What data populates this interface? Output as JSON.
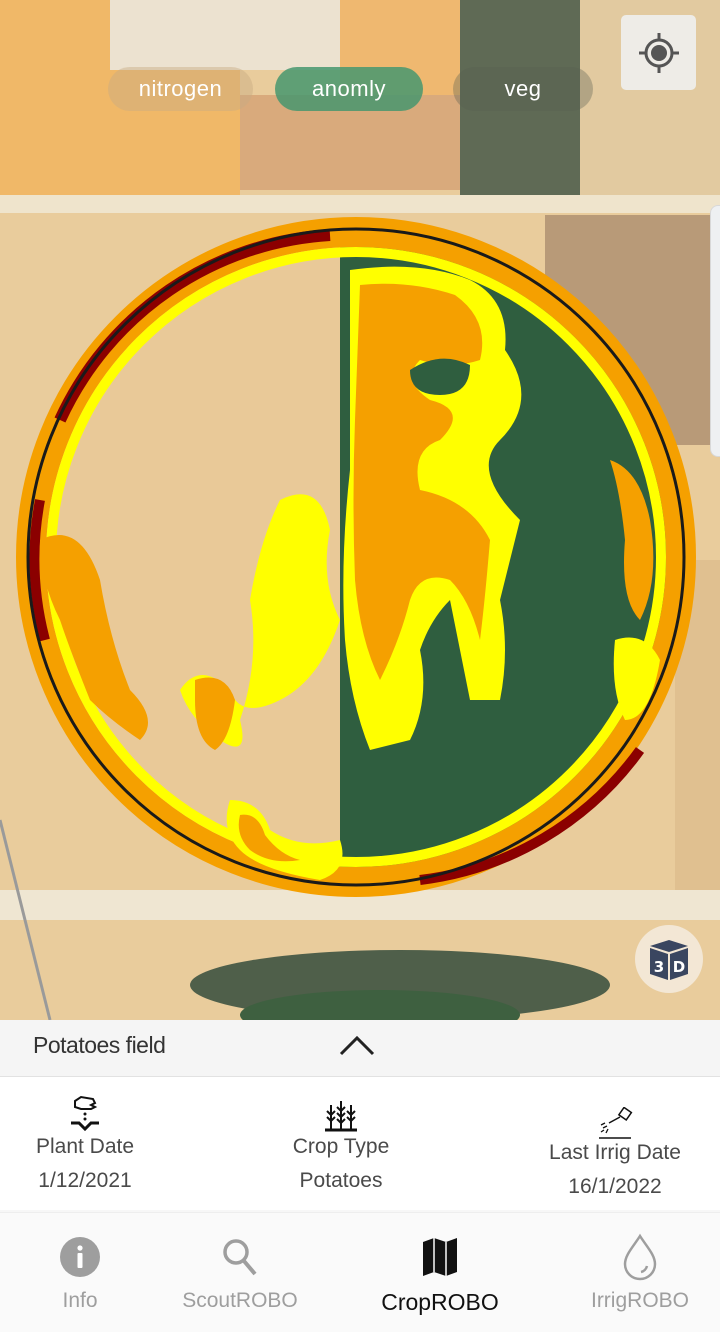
{
  "map": {
    "layer_tabs": [
      {
        "label": "nitrogen",
        "selected": false
      },
      {
        "label": "anomly",
        "selected": true
      },
      {
        "label": "veg",
        "selected": false
      }
    ],
    "locate_icon": "crosshair-locate-icon",
    "view_3d_label": "3D",
    "anomaly_colors": {
      "severe": "#8b0000",
      "high": "#f5a000",
      "moderate": "#ffff00",
      "boundary": "#1a1a1a"
    }
  },
  "field": {
    "name": "Potatoes field",
    "expand_icon": "chevron-up-icon"
  },
  "info": [
    {
      "icon": "hand-sowing-icon",
      "label": "Plant Date",
      "value": "1/12/2021"
    },
    {
      "icon": "wheat-crop-icon",
      "label": "Crop Type",
      "value": "Potatoes"
    },
    {
      "icon": "watering-can-icon",
      "label": "Last Irrig Date",
      "value": "16/1/2022"
    }
  ],
  "nav": [
    {
      "icon": "info-icon",
      "label": "Info",
      "active": false
    },
    {
      "icon": "search-icon",
      "label": "ScoutROBO",
      "active": false
    },
    {
      "icon": "map-icon",
      "label": "CropROBO",
      "active": true
    },
    {
      "icon": "water-drop-icon",
      "label": "IrrigROBO",
      "active": false
    }
  ]
}
